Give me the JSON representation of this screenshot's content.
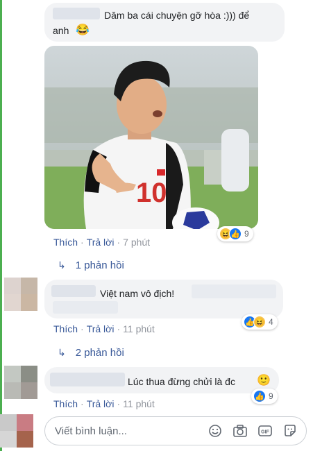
{
  "comments": [
    {
      "text_line1": "Dăm ba cái chuyện gỡ hòa :))) để",
      "text_line2": "anh",
      "emoji": "😂",
      "actions": {
        "like": "Thích",
        "reply": "Trả lời",
        "time": "7 phút"
      },
      "reactions": {
        "icons": [
          "haha",
          "like"
        ],
        "count": "9"
      },
      "replies": "1 phản hồi"
    },
    {
      "text": "Việt nam vô địch!",
      "actions": {
        "like": "Thích",
        "reply": "Trả lời",
        "time": "11 phút"
      },
      "reactions": {
        "icons": [
          "like",
          "haha"
        ],
        "count": "4"
      },
      "replies": "2 phản hồi"
    },
    {
      "text": "Lúc thua đừng chửi là đc",
      "emoji": "🙂",
      "actions": {
        "like": "Thích",
        "reply": "Trả lời",
        "time": "11 phút"
      },
      "reactions": {
        "icons": [
          "like"
        ],
        "count": "9"
      }
    }
  ],
  "composer": {
    "placeholder": "Viết bình luận...",
    "icons": [
      "smiley-icon",
      "camera-icon",
      "gif-icon",
      "sticker-icon"
    ]
  },
  "colors": {
    "link": "#385898",
    "bubble": "#f2f3f5",
    "like_blue": "#1877f2",
    "haha_yellow": "#f7c34a",
    "edge_green": "#4caf50"
  }
}
